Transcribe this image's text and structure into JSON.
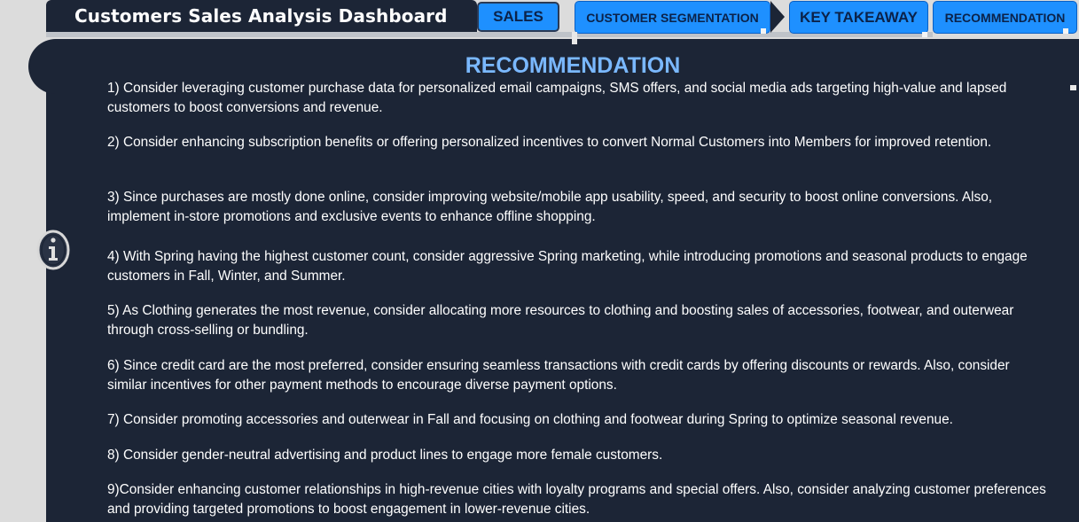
{
  "header": {
    "title": "Customers Sales Analysis Dashboard"
  },
  "nav": {
    "sales": "SALES",
    "customer_segmentation": "CUSTOMER SEGMENTATION",
    "key_takeaway": "KEY TAKEAWAY",
    "recommendation": "RECOMMENDATION"
  },
  "main": {
    "heading": "RECOMMENDATION",
    "recommendations": [
      "1) Consider leveraging customer purchase data for personalized email campaigns, SMS offers, and social media ads targeting high-value and lapsed customers to boost conversions and revenue.",
      "2) Consider enhancing subscription benefits or offering personalized incentives to convert Normal Customers into Members for improved retention.",
      "3) Since purchases are mostly done online, consider improving website/mobile app usability, speed, and security to boost online conversions. Also, implement in-store promotions and exclusive events to enhance offline shopping.",
      "4) With Spring having the highest customer count, consider aggressive Spring marketing, while introducing promotions and seasonal products to engage customers in Fall, Winter, and Summer.",
      "5)  As Clothing generates the most revenue, consider allocating more resources to clothing and boosting sales of accessories, footwear, and outerwear  through cross-selling or bundling.",
      "6)  Since credit card are the most preferred, consider ensuring seamless transactions with credit cards by offering discounts or rewards. Also, consider similar incentives for other payment methods to encourage diverse payment options.",
      "7) Consider promoting accessories and outerwear in Fall and focusing on clothing and footwear during Spring to optimize seasonal revenue.",
      "8)  Consider gender-neutral advertising and product lines to engage more female customers.",
      "9)Consider enhancing customer relationships in high-revenue cities with loyalty programs and special offers. Also, consider analyzing customer preferences and providing targeted promotions to boost engagement in lower-revenue cities."
    ]
  },
  "icons": {
    "info": "info-circle-icon"
  },
  "colors": {
    "panel_bg": "#1c2536",
    "nav_button": "#1e90ff",
    "heading": "#7ab8ff",
    "text": "#ffffff"
  }
}
